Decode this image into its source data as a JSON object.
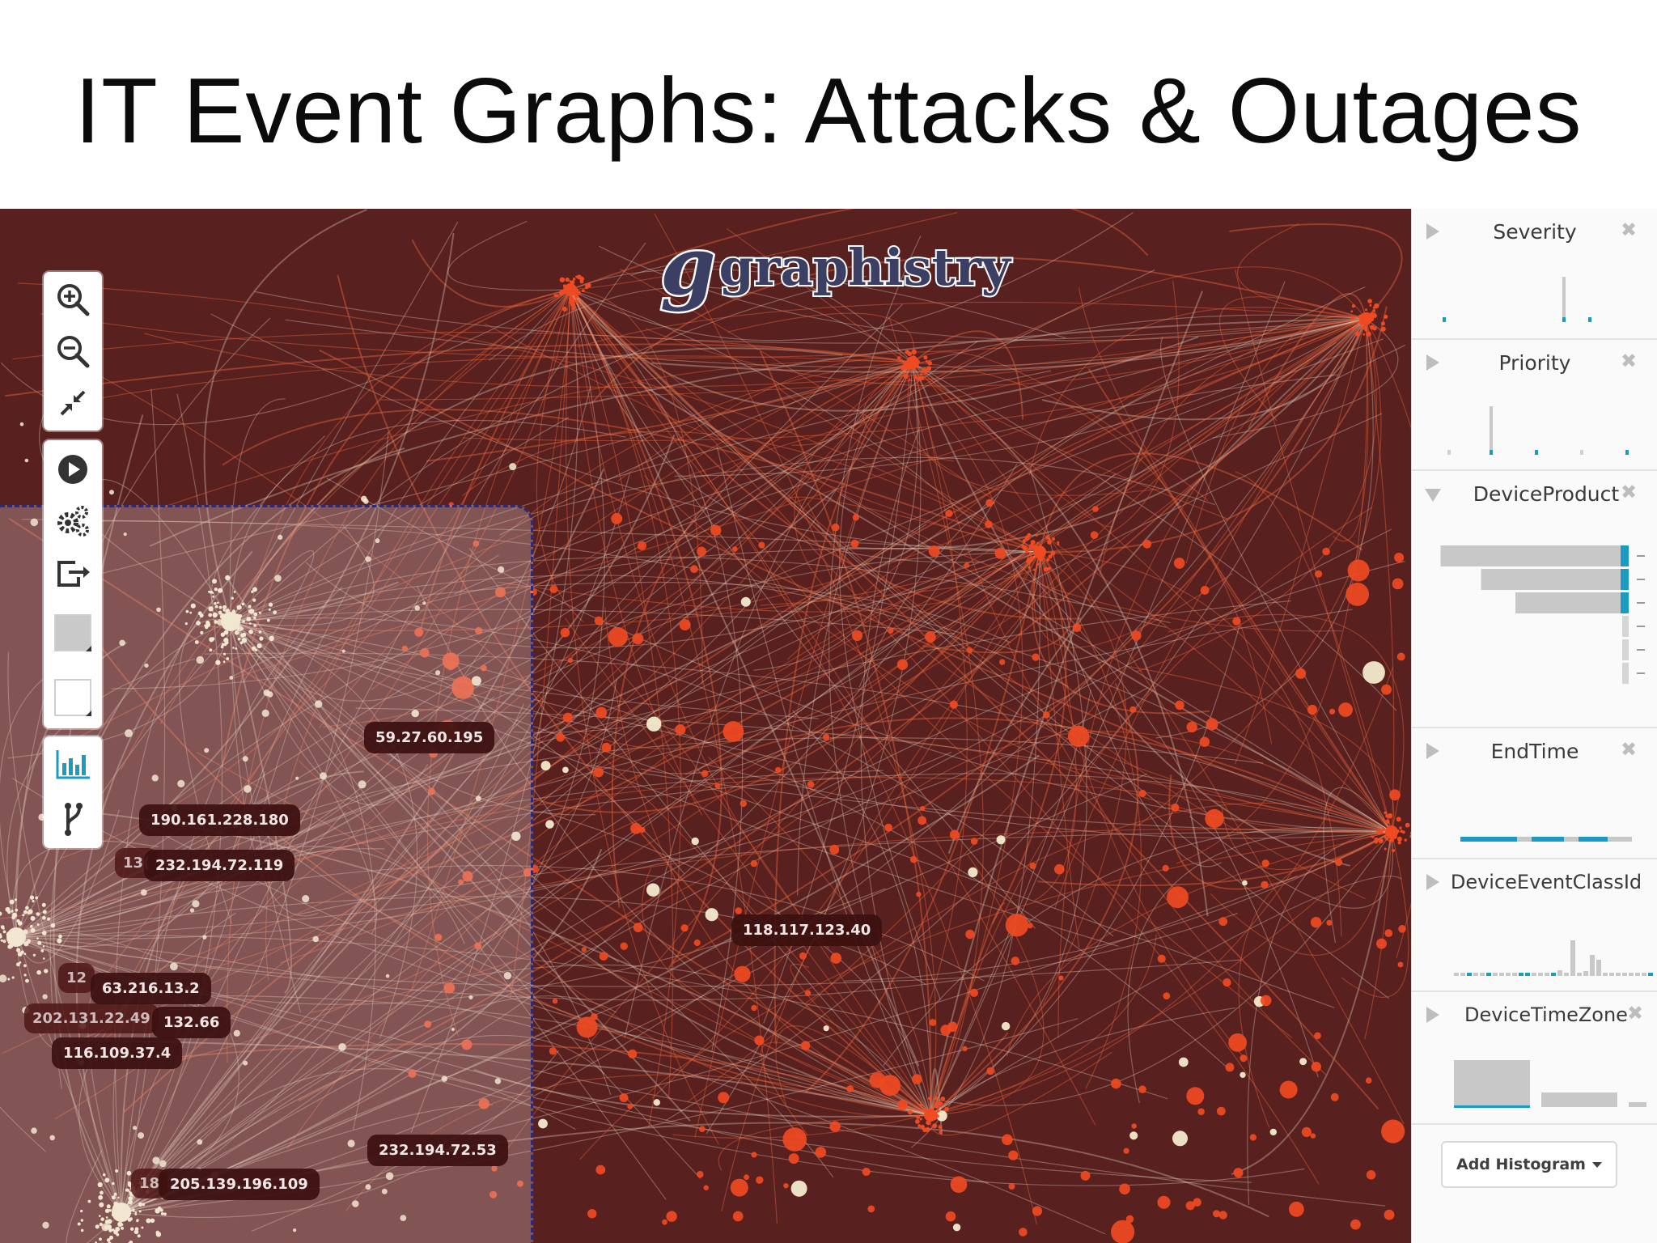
{
  "slide": {
    "title": "IT Event Graphs: Attacks & Outages"
  },
  "logo": {
    "mark": "g",
    "text": "graphistry"
  },
  "colors": {
    "canvas_bg": "#58201f",
    "edge_light": "#e8d7c4",
    "edge_orange": "#e6643a",
    "node_orange": "#ef4a22",
    "node_cream": "#f7f1d2",
    "histogram_bar": "#c8c8c8",
    "histogram_accent": "#1b9bc3"
  },
  "toolbar": {
    "icons": [
      "zoom-in-icon",
      "zoom-out-icon",
      "collapse-icon",
      "play-icon",
      "settings-icon",
      "export-icon",
      "background-color-swatch",
      "foreground-color-swatch",
      "histogram-icon",
      "branch-icon"
    ]
  },
  "ip_labels": [
    {
      "text": "59.27.60.195"
    },
    {
      "text": "190.161.228.180"
    },
    {
      "text": "232.194.72.119"
    },
    {
      "text": "118.117.123.40"
    },
    {
      "text": "63.216.13.2"
    },
    {
      "text": "132.66"
    },
    {
      "text": "116.109.37.4"
    },
    {
      "text": "232.194.72.53"
    },
    {
      "text": "205.139.196.109"
    }
  ],
  "ip_label_fragments": [
    {
      "text": "13("
    },
    {
      "text": "12"
    },
    {
      "text": "202.131.22.49"
    },
    {
      "text": "18"
    }
  ],
  "histograms": {
    "panels": [
      {
        "title": "Severity",
        "open": false
      },
      {
        "title": "Priority",
        "open": false
      },
      {
        "title": "DeviceProduct",
        "open": true
      },
      {
        "title": "EndTime",
        "open": false
      },
      {
        "title": "DeviceEventClassId",
        "open": false
      },
      {
        "title": "DeviceTimeZone",
        "open": false
      }
    ],
    "close_glyph": "✖",
    "device_product_bars": [
      0.93,
      0.73,
      0.56,
      0.0,
      0.0,
      0.0
    ],
    "add_button": "Add Histogram"
  }
}
